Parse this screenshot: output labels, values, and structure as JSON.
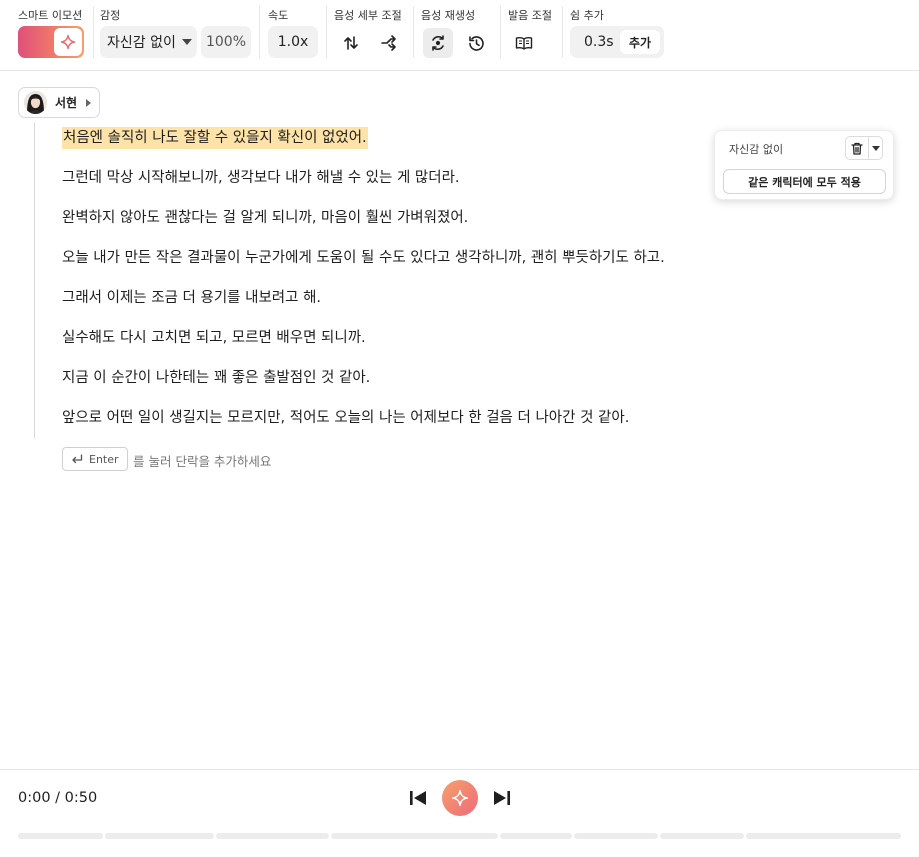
{
  "toolbar": {
    "smart_emotion_label": "스마트 이모션",
    "emotion_label": "감정",
    "emotion_value": "자신감 없이",
    "emotion_intensity": "100%",
    "speed_label": "속도",
    "speed_value": "1.0x",
    "voice_detail_label": "음성 세부 조절",
    "regenerate_label": "음성 재생성",
    "pronunciation_label": "발음 조절",
    "pause_label": "쉼 추가",
    "pause_value": "0.3s",
    "pause_add_label": "추가"
  },
  "speaker": {
    "name": "서현"
  },
  "paragraphs": [
    "처음엔 솔직히 나도 잘할 수 있을지 확신이 없었어.",
    "그런데 막상 시작해보니까, 생각보다 내가 해낼 수 있는 게 많더라.",
    "완벽하지 않아도 괜찮다는 걸 알게 되니까, 마음이 훨씬 가벼워졌어.",
    "오늘 내가 만든 작은 결과물이 누군가에게 도움이 될 수도 있다고 생각하니까, 괜히 뿌듯하기도 하고.",
    "그래서 이제는 조금 더 용기를 내보려고 해.",
    "실수해도 다시 고치면 되고, 모르면 배우면 되니까.",
    "지금 이 순간이 나한테는 꽤 좋은 출발점인 것 같아.",
    "앞으로 어떤 일이 생길지는 모르지만, 적어도 오늘의 나는 어제보다 한 걸음 더 나아간 것 같아."
  ],
  "enter_hint": {
    "key_label": "Enter",
    "text": "를 눌러 단락을 추가하세요"
  },
  "popover": {
    "emotion": "자신감 없이",
    "apply_all_label": "같은 캐릭터에 모두 적용"
  },
  "player": {
    "time": "0:00 / 0:50"
  },
  "colors": {
    "highlight": "#fde3a8",
    "accent_start": "#e0507a",
    "accent_end": "#f6a06a"
  }
}
